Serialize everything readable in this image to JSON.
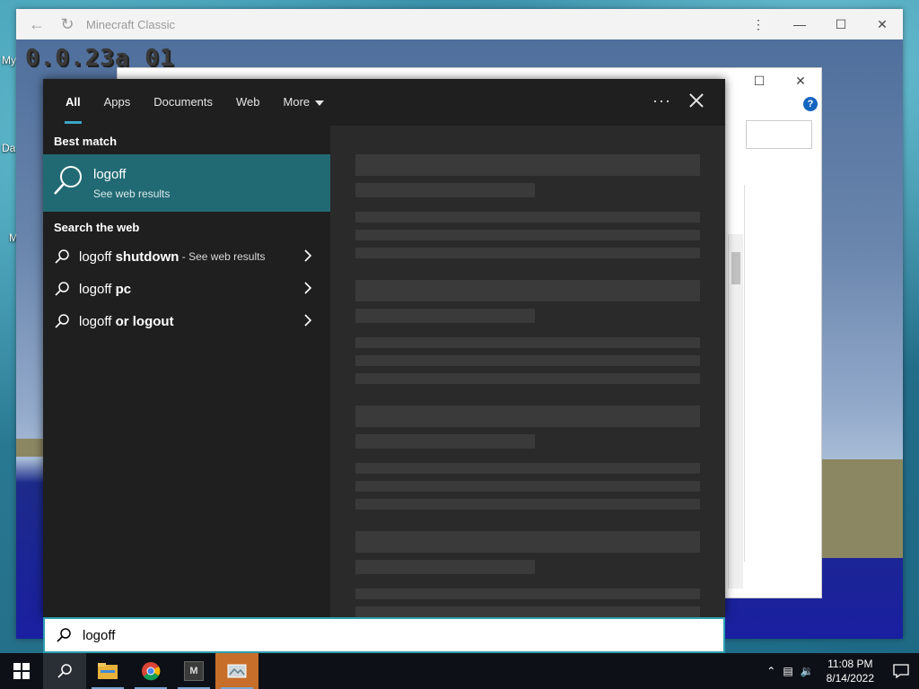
{
  "desktop": {
    "labels": [
      "My",
      "Da",
      "M"
    ]
  },
  "minecraft": {
    "title": "Minecraft Classic",
    "version": "0.0.23a_01"
  },
  "search": {
    "tabs": [
      "All",
      "Apps",
      "Documents",
      "Web",
      "More"
    ],
    "active_tab": "All",
    "more_icon": "ellipsis-icon",
    "best_match_heading": "Best match",
    "best_match": {
      "title": "logoff",
      "subtitle": "See web results"
    },
    "search_web_heading": "Search the web",
    "web_results": [
      {
        "prefix": "logoff ",
        "bold": "shutdown",
        "suffix": " - See web results"
      },
      {
        "prefix": "logoff ",
        "bold": "pc",
        "suffix": ""
      },
      {
        "prefix": "logoff ",
        "bold": "or logout",
        "suffix": ""
      }
    ],
    "query": "logoff"
  },
  "taskbar": {
    "apps": [
      "start-icon",
      "search-icon",
      "file-explorer-icon",
      "chrome-icon",
      "m-app-icon",
      "image-app-icon"
    ],
    "m_app_letter": "M",
    "time": "11:08 PM",
    "date": "8/14/2022"
  },
  "colors": {
    "accent": "#3ca5c6",
    "best_match_bg": "#216a73",
    "panel_bg": "#1f1f1f",
    "preview_bg": "#2a2a2a",
    "taskbar_bg": "#0d1117"
  }
}
